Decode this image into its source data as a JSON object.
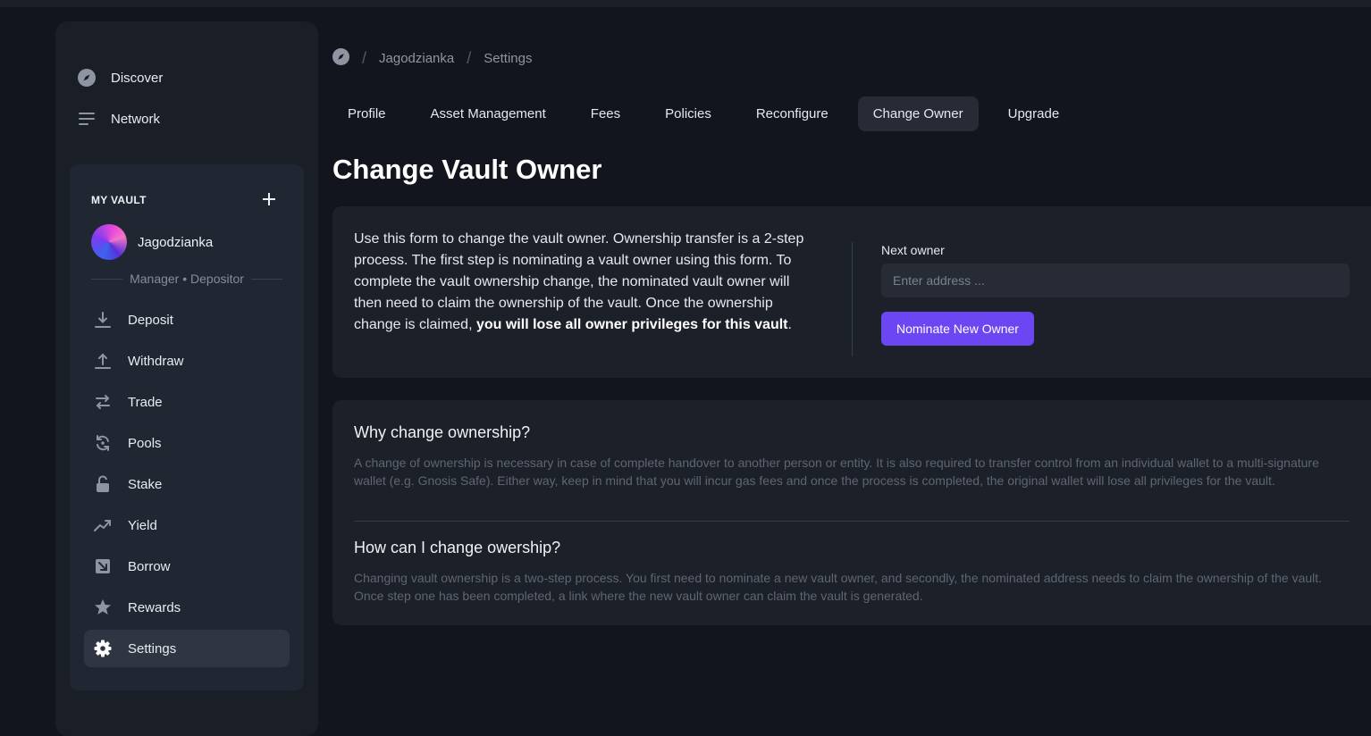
{
  "sidebar": {
    "nav": [
      {
        "label": "Discover",
        "icon": "compass-icon"
      },
      {
        "label": "Network",
        "icon": "lines-icon"
      }
    ],
    "vault": {
      "heading": "MY VAULT",
      "name": "Jagodzianka",
      "roles": "Manager • Depositor",
      "menu": [
        {
          "label": "Deposit",
          "icon": "download-icon"
        },
        {
          "label": "Withdraw",
          "icon": "upload-icon"
        },
        {
          "label": "Trade",
          "icon": "swap-icon"
        },
        {
          "label": "Pools",
          "icon": "refresh-icon"
        },
        {
          "label": "Stake",
          "icon": "unlock-icon"
        },
        {
          "label": "Yield",
          "icon": "trending-up-icon"
        },
        {
          "label": "Borrow",
          "icon": "borrow-icon"
        },
        {
          "label": "Rewards",
          "icon": "star-icon"
        },
        {
          "label": "Settings",
          "icon": "gear-icon",
          "active": true
        }
      ]
    }
  },
  "breadcrumb": [
    "Jagodzianka",
    "Settings"
  ],
  "tabs": [
    "Profile",
    "Asset Management",
    "Fees",
    "Policies",
    "Reconfigure",
    "Change Owner",
    "Upgrade"
  ],
  "active_tab": "Change Owner",
  "page_title": "Change Vault Owner",
  "form": {
    "description": "Use this form to change the vault owner. Ownership transfer is a 2-step process. The first step is nominating a vault owner using this form. To complete the vault ownership change, the nominated vault owner will then need to claim the ownership of the vault. Once the ownership change is claimed, ",
    "description_bold": "you will lose all owner privileges for this vault",
    "description_end": ".",
    "field_label": "Next owner",
    "field_placeholder": "Enter address ...",
    "field_value": "",
    "button_label": "Nominate New Owner"
  },
  "faq": [
    {
      "question": "Why change ownership?",
      "answer": "A change of ownership is necessary in case of complete handover to another person or entity. It is also required to transfer control from an individual wallet to a multi-signature wallet (e.g. Gnosis Safe). Either way, keep in mind that you will incur gas fees and once the process is completed, the original wallet will lose all privileges for the vault."
    },
    {
      "question": "How can I change owership?",
      "answer": "Changing vault ownership is a two-step process. You first need to nominate a new vault owner, and secondly, the nominated address needs to claim the ownership of the vault. Once step one has been completed, a link where the new vault owner can claim the vault is generated."
    }
  ],
  "colors": {
    "background": "#12151d",
    "sidebar": "#1a1e27",
    "panel": "#212633",
    "card": "#1c2029",
    "accent": "#6b46f2"
  }
}
